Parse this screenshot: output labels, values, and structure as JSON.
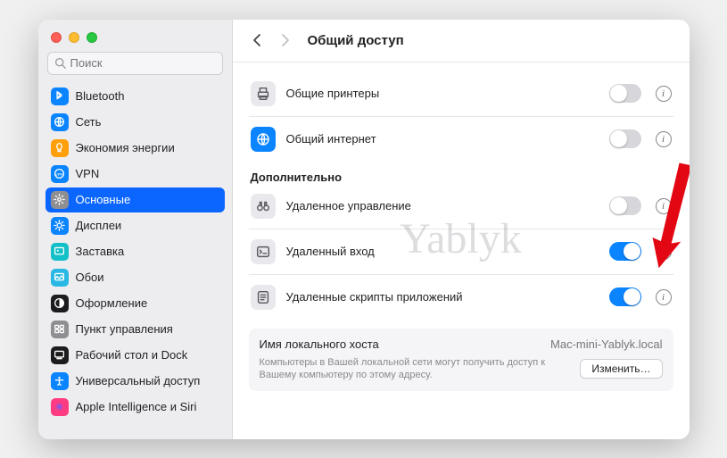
{
  "search": {
    "placeholder": "Поиск"
  },
  "sidebar": {
    "items": [
      {
        "label": "Bluetooth",
        "color": "#0a84ff",
        "glyph": "bt"
      },
      {
        "label": "Сеть",
        "color": "#0a84ff",
        "glyph": "globe"
      },
      {
        "label": "Экономия энергии",
        "color": "#ff9f0a",
        "glyph": "bulb"
      },
      {
        "label": "VPN",
        "color": "#0a84ff",
        "glyph": "vpn"
      },
      {
        "label": "Основные",
        "color": "#8e8e93",
        "glyph": "gear"
      },
      {
        "label": "Дисплеи",
        "color": "#0a84ff",
        "glyph": "sun"
      },
      {
        "label": "Заставка",
        "color": "#14c0c7",
        "glyph": "screensaver"
      },
      {
        "label": "Обои",
        "color": "#28b8e3",
        "glyph": "wallpaper"
      },
      {
        "label": "Оформление",
        "color": "#1c1c1e",
        "glyph": "appearance"
      },
      {
        "label": "Пункт управления",
        "color": "#8e8e93",
        "glyph": "controlcenter"
      },
      {
        "label": "Рабочий стол и Dock",
        "color": "#1c1c1e",
        "glyph": "dock"
      },
      {
        "label": "Универсальный доступ",
        "color": "#0a84ff",
        "glyph": "access"
      },
      {
        "label": "Apple Intelligence и Siri",
        "color": "#ff3b82",
        "glyph": "siri"
      }
    ],
    "selected_index": 4
  },
  "header": {
    "title": "Общий доступ"
  },
  "sharing": {
    "top": [
      {
        "label": "Общие принтеры",
        "on": false,
        "info": true,
        "icon": "printer"
      },
      {
        "label": "Общий интернет",
        "on": false,
        "info": true,
        "icon": "globe"
      }
    ],
    "advanced_title": "Дополнительно",
    "advanced": [
      {
        "label": "Удаленное управление",
        "on": false,
        "info": true,
        "icon": "binoculars",
        "emph": false
      },
      {
        "label": "Удаленный вход",
        "on": true,
        "info": true,
        "icon": "terminal",
        "emph": true
      },
      {
        "label": "Удаленные скрипты приложений",
        "on": true,
        "info": true,
        "icon": "script",
        "emph": false
      }
    ]
  },
  "host": {
    "label": "Имя локального хоста",
    "value": "Mac-mini-Yablyk.local",
    "note": "Компьютеры в Вашей локальной сети могут получить доступ к Вашему компьютеру по этому адресу.",
    "edit_btn": "Изменить…"
  },
  "watermark": "Yablyk"
}
